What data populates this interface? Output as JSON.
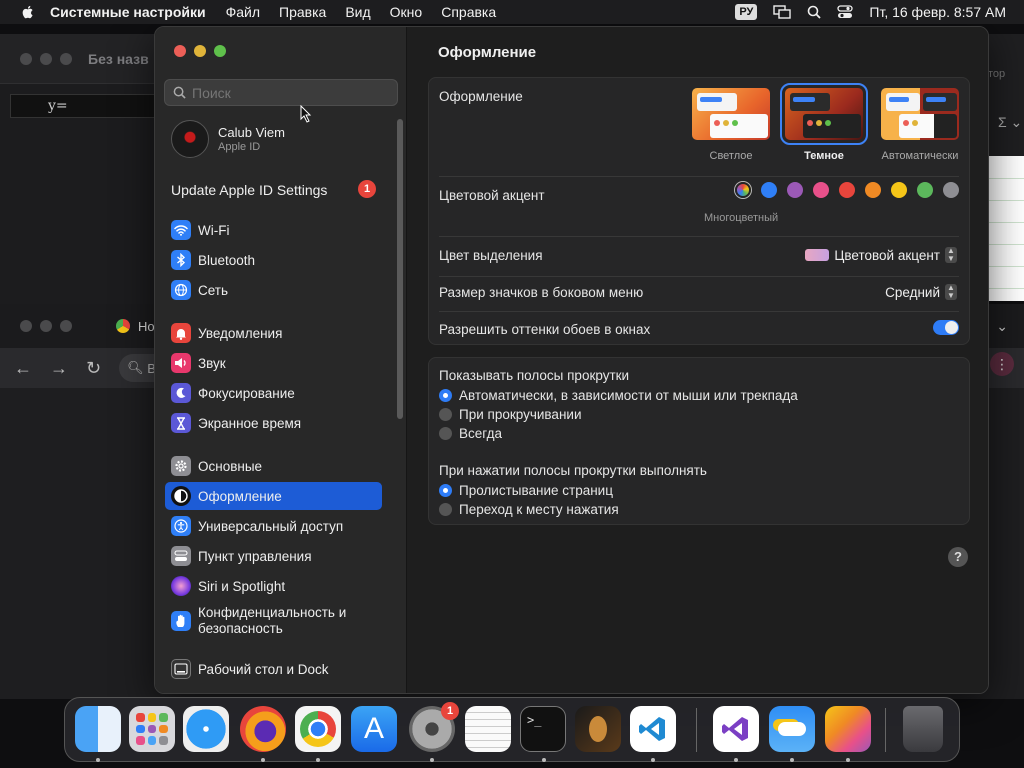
{
  "menubar": {
    "app_name": "Системные настройки",
    "items": [
      "Файл",
      "Правка",
      "Вид",
      "Окно",
      "Справка"
    ],
    "keyboard_layout": "РУ",
    "clock": "Пт, 16 февр.  8:57 AM"
  },
  "background": {
    "calc_title": "Без назв",
    "calc_expr": "y=",
    "side_text": "тор",
    "sigma": "Σ ⌄",
    "browser_tab": "Нов",
    "browser_omni": "В"
  },
  "window": {
    "search_placeholder": "Поиск",
    "account": {
      "name": "Calub Viem",
      "subtitle": "Apple ID"
    },
    "update": {
      "label": "Update Apple ID Settings",
      "badge": "1"
    },
    "sidebar": [
      {
        "label": "Wi-Fi",
        "icon": "wifi-icon",
        "color": "#2f7ff7"
      },
      {
        "label": "Bluetooth",
        "icon": "bluetooth-icon",
        "color": "#2f7ff7"
      },
      {
        "label": "Сеть",
        "icon": "globe-icon",
        "color": "#2f7ff7"
      },
      {
        "label": "Уведомления",
        "icon": "bell-icon",
        "color": "#e8453c"
      },
      {
        "label": "Звук",
        "icon": "speaker-icon",
        "color": "#e8386c"
      },
      {
        "label": "Фокусирование",
        "icon": "moon-icon",
        "color": "#5b58d6"
      },
      {
        "label": "Экранное время",
        "icon": "hourglass-icon",
        "color": "#5b58d6"
      },
      {
        "label": "Основные",
        "icon": "gear-icon",
        "color": "#8e8e93"
      },
      {
        "label": "Оформление",
        "icon": "appearance-icon",
        "color": "#111111"
      },
      {
        "label": "Универсальный доступ",
        "icon": "accessibility-icon",
        "color": "#2f7ff7"
      },
      {
        "label": "Пункт управления",
        "icon": "control-center-icon",
        "color": "#8e8e93"
      },
      {
        "label": "Siri и Spotlight",
        "icon": "siri-icon",
        "color": "#b84fe0"
      },
      {
        "label": "Конфиденциальность и безопасность",
        "icon": "hand-icon",
        "color": "#2f7ff7"
      },
      {
        "label": "Рабочий стол и Dock",
        "icon": "dock-icon",
        "color": "#333333"
      }
    ],
    "title": "Оформление",
    "appearance": {
      "label": "Оформление",
      "options": [
        "Светлое",
        "Темное",
        "Автоматически"
      ],
      "selected": "Темное"
    },
    "accent": {
      "label": "Цветовой акцент",
      "colors": [
        "multicolor",
        "#2f7ff7",
        "#9b59b6",
        "#e8508a",
        "#e8453c",
        "#f08a24",
        "#f5c518",
        "#5cb85c",
        "#8e8e93"
      ],
      "selected_name": "Многоцветный"
    },
    "highlight": {
      "label": "Цвет выделения",
      "value": "Цветовой акцент"
    },
    "sidebar_icon_size": {
      "label": "Размер значков в боковом меню",
      "value": "Средний"
    },
    "wallpaper_tint": {
      "label": "Разрешить оттенки обоев в окнах",
      "on": true
    },
    "scrollbars": {
      "label": "Показывать полосы прокрутки",
      "options": [
        "Автоматически, в зависимости от мыши или трекпада",
        "При прокручивании",
        "Всегда"
      ],
      "selected": 0
    },
    "scroll_click": {
      "label": "При нажатии полосы прокрутки выполнять",
      "options": [
        "Пролистывание страниц",
        "Переход к месту нажатия"
      ],
      "selected": 0
    },
    "help": "?"
  },
  "dock": {
    "apps": [
      "finder",
      "launchpad",
      "safari",
      "firefox",
      "chrome",
      "app-store",
      "system-settings",
      "textedit",
      "terminal",
      "garageband",
      "vscode",
      "visual-studio",
      "weather",
      "pages",
      "trash"
    ],
    "settings_badge": "1"
  }
}
